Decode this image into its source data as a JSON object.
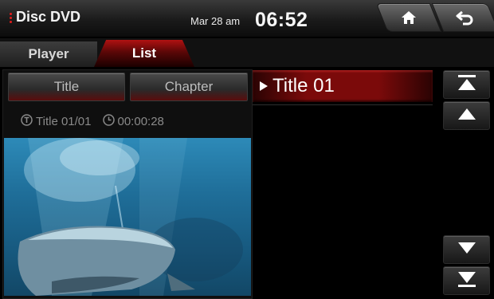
{
  "header": {
    "app_title": "Disc DVD",
    "date": "Mar 28 am",
    "time": "06:52",
    "home_icon": "home-icon",
    "back_icon": "back-arrow-icon"
  },
  "tabs": [
    {
      "label": "Player",
      "active": false
    },
    {
      "label": "List",
      "active": true
    }
  ],
  "left_panel": {
    "title_button": "Title",
    "chapter_button": "Chapter",
    "title_info": "Title 01/01",
    "elapsed": "00:00:28"
  },
  "list": {
    "items": [
      {
        "label": "Title 01",
        "selected": true
      }
    ]
  },
  "colors": {
    "accent_red": "#b01212",
    "background": "#000000"
  }
}
